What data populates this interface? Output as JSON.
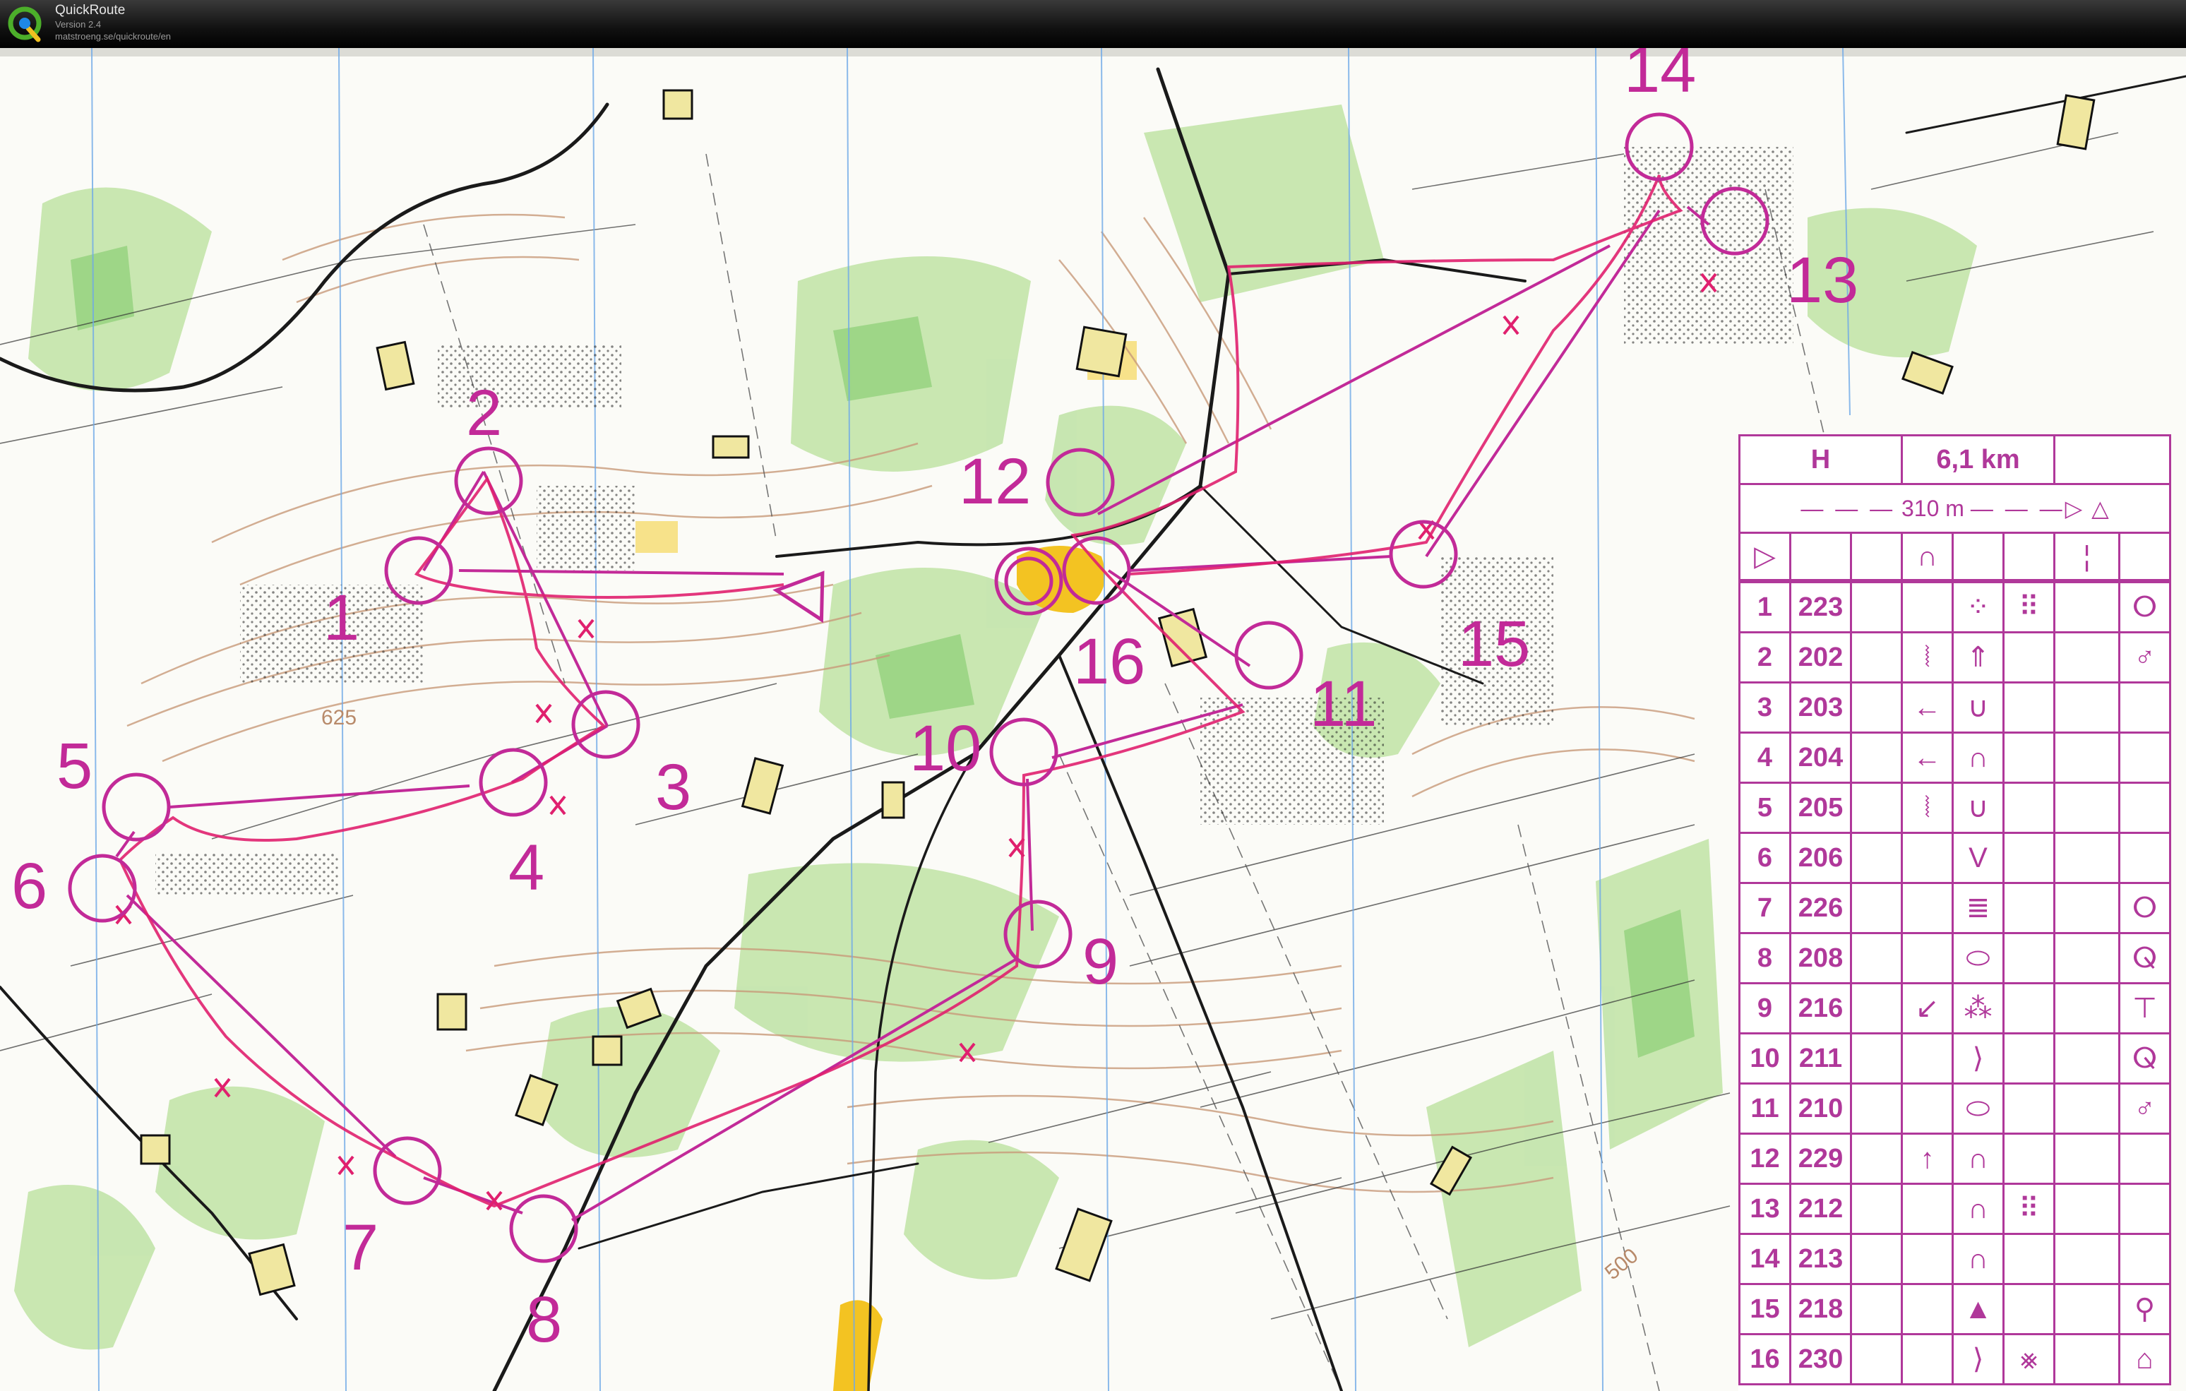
{
  "app": {
    "name": "QuickRoute",
    "version": "Version 2.4",
    "url": "matstroeng.se/quickroute/en"
  },
  "colors": {
    "route": "#e0206e",
    "course": "#c22a98",
    "description_ink": "#b0389a"
  },
  "map": {
    "control_labels": [
      "1",
      "2",
      "3",
      "4",
      "5",
      "6",
      "7",
      "8",
      "9",
      "10",
      "11",
      "12",
      "13",
      "14",
      "15",
      "16"
    ],
    "contour_labels": [
      "625",
      "500"
    ]
  },
  "description": {
    "class": "H",
    "length": "6,1 km",
    "leg_text": "310 m",
    "start_symbol": "start-triangle-icon",
    "controls": [
      {
        "num": "1",
        "code": "223",
        "c": "",
        "d": "",
        "e": "knoll-dotted-icon",
        "f": "dots-icon",
        "h": "first-aid-icon"
      },
      {
        "num": "2",
        "code": "202",
        "c": "",
        "d": "ruined-fence-icon",
        "e": "thicket-icon",
        "f": "",
        "h": "water-icon"
      },
      {
        "num": "3",
        "code": "203",
        "c": "",
        "d": "west-icon",
        "e": "depression-icon",
        "f": "",
        "h": ""
      },
      {
        "num": "4",
        "code": "204",
        "c": "",
        "d": "west-icon",
        "e": "knoll-icon",
        "f": "",
        "h": ""
      },
      {
        "num": "5",
        "code": "205",
        "c": "",
        "d": "ruined-fence-icon",
        "e": "depression-icon",
        "f": "",
        "h": ""
      },
      {
        "num": "6",
        "code": "206",
        "c": "",
        "d": "",
        "e": "gully-icon",
        "f": "",
        "h": ""
      },
      {
        "num": "7",
        "code": "226",
        "c": "",
        "d": "",
        "e": "marsh-icon",
        "f": "",
        "h": "first-aid-icon"
      },
      {
        "num": "8",
        "code": "208",
        "c": "",
        "d": "",
        "e": "elongated-knoll-icon",
        "f": "",
        "h": "radio-icon"
      },
      {
        "num": "9",
        "code": "216",
        "c": "",
        "d": "south-west-icon",
        "e": "rocky-ground-icon",
        "f": "",
        "h": "manned-icon"
      },
      {
        "num": "10",
        "code": "211",
        "c": "",
        "d": "",
        "e": "re-entrant-icon",
        "f": "",
        "h": "radio-icon"
      },
      {
        "num": "11",
        "code": "210",
        "c": "",
        "d": "",
        "e": "elongated-knoll-icon",
        "f": "",
        "h": "water-icon"
      },
      {
        "num": "12",
        "code": "229",
        "c": "",
        "d": "north-icon",
        "e": "knoll-icon",
        "f": "",
        "h": ""
      },
      {
        "num": "13",
        "code": "212",
        "c": "",
        "d": "",
        "e": "knoll-icon",
        "f": "dots-icon",
        "h": ""
      },
      {
        "num": "14",
        "code": "213",
        "c": "",
        "d": "",
        "e": "knoll-icon",
        "f": "",
        "h": ""
      },
      {
        "num": "15",
        "code": "218",
        "c": "",
        "d": "",
        "e": "boulder-icon",
        "f": "",
        "h": "refreshment-icon"
      },
      {
        "num": "16",
        "code": "230",
        "c": "",
        "d": "",
        "e": "re-entrant-icon",
        "f": "crossed-dots-icon",
        "h": "shelter-icon"
      }
    ]
  }
}
